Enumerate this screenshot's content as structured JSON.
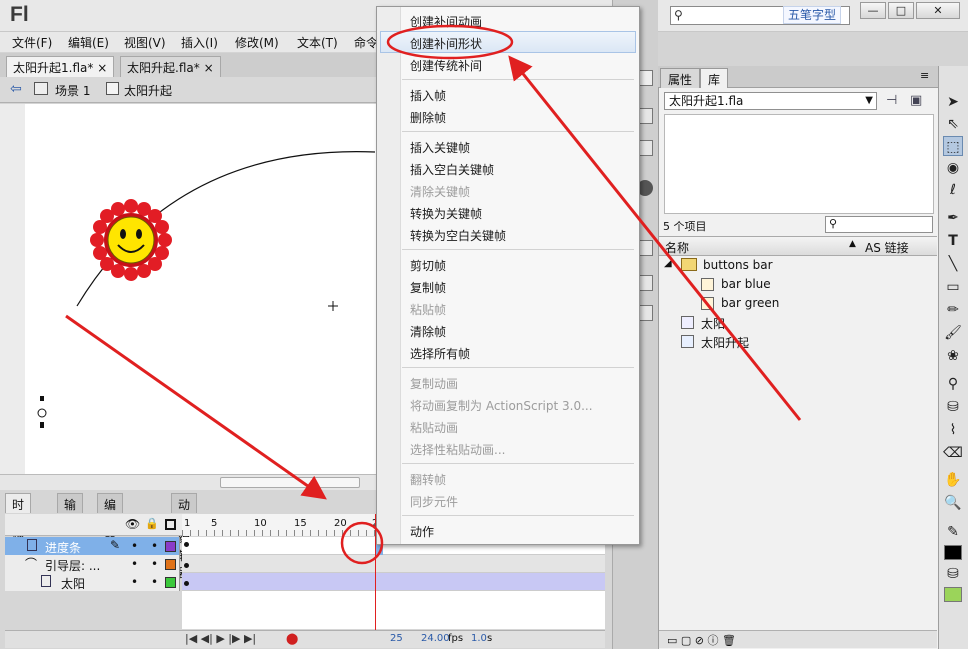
{
  "app": {
    "logo": "Fl",
    "watermark": "五笔字型"
  },
  "window_buttons": {
    "minimize": "—",
    "restore": "□",
    "close": "✕"
  },
  "menubar": [
    "文件(F)",
    "编辑(E)",
    "视图(V)",
    "插入(I)",
    "修改(M)",
    "文本(T)",
    "命令"
  ],
  "doc_tabs": [
    {
      "label": "太阳升起1.fla*"
    },
    {
      "label": "太阳升起.fla*"
    }
  ],
  "scene": {
    "scene_label": "场景 1",
    "symbol_label": "太阳升起"
  },
  "timeline": {
    "tabs": [
      "时间轴",
      "输出",
      "编译器错误",
      "动画编辑器"
    ],
    "ruler": [
      "1",
      "5",
      "10",
      "15",
      "20",
      "2"
    ],
    "layers": [
      {
        "name": "进度条",
        "color": "#8a3cc8"
      },
      {
        "name": "引导层: ...",
        "color": "#e0731a"
      },
      {
        "name": "太阳",
        "color": "#3cc83c"
      }
    ],
    "footer": {
      "frame": "25",
      "fps": "24.00",
      "fps_unit": "fps",
      "time": "1.0",
      "time_unit": "s"
    }
  },
  "context_menu": {
    "items": [
      {
        "label": "创建补间动画",
        "disabled": false
      },
      {
        "label": "创建补间形状",
        "disabled": false
      },
      {
        "label": "创建传统补间",
        "disabled": false
      },
      {
        "label": "插入帧",
        "disabled": false
      },
      {
        "label": "删除帧",
        "disabled": false
      },
      {
        "label": "插入关键帧",
        "disabled": false
      },
      {
        "label": "插入空白关键帧",
        "disabled": false
      },
      {
        "label": "清除关键帧",
        "disabled": true
      },
      {
        "label": "转换为关键帧",
        "disabled": false
      },
      {
        "label": "转换为空白关键帧",
        "disabled": false
      },
      {
        "label": "剪切帧",
        "disabled": false
      },
      {
        "label": "复制帧",
        "disabled": false
      },
      {
        "label": "粘贴帧",
        "disabled": true
      },
      {
        "label": "清除帧",
        "disabled": false
      },
      {
        "label": "选择所有帧",
        "disabled": false
      },
      {
        "label": "复制动画",
        "disabled": true
      },
      {
        "label": "将动画复制为 ActionScript 3.0...",
        "disabled": true
      },
      {
        "label": "粘贴动画",
        "disabled": true
      },
      {
        "label": "选择性粘贴动画...",
        "disabled": true
      },
      {
        "label": "翻转帧",
        "disabled": true
      },
      {
        "label": "同步元件",
        "disabled": true
      },
      {
        "label": "动作",
        "disabled": false
      }
    ],
    "highlighted": "创建补间形状"
  },
  "library": {
    "tabs": [
      "属性",
      "库"
    ],
    "selected_file": "太阳升起1.fla",
    "item_count": "5 个项目",
    "columns": {
      "name": "名称",
      "linkage": "AS 链接"
    },
    "items": [
      {
        "label": "buttons bar",
        "icon": "folder-icon"
      },
      {
        "label": "bar blue",
        "icon": "button-symbol-icon"
      },
      {
        "label": "bar green",
        "icon": "button-symbol-icon"
      },
      {
        "label": "太阳",
        "icon": "graphic-symbol-icon"
      },
      {
        "label": "太阳升起",
        "icon": "movieclip-symbol-icon"
      }
    ]
  },
  "colors": {
    "annotation_red": "#e02020",
    "selected_layer": "#7fb0e8",
    "frame_span": "#c8c8f4",
    "stroke_swatch": "#000000",
    "fill_swatch": "#9bd45a"
  }
}
